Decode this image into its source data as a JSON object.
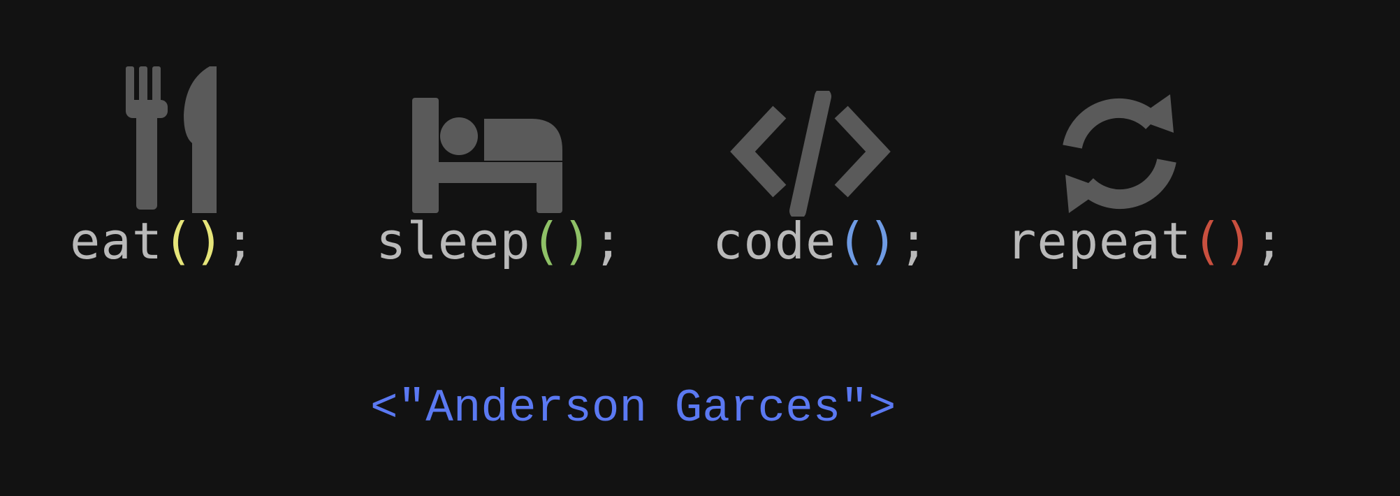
{
  "colors": {
    "background": "#121212",
    "icon": "#5a5a5a",
    "text": "#b9b9b9",
    "eat_parens": "#e6e57a",
    "sleep_parens": "#8fc167",
    "code_parens": "#6f9be3",
    "repeat_parens": "#c9503f",
    "signature": "#5b79f2"
  },
  "items": [
    {
      "icon": "fork-knife-icon",
      "name": "eat",
      "parens": "()",
      "terminator": ";"
    },
    {
      "icon": "bed-icon",
      "name": "sleep",
      "parens": "()",
      "terminator": ";"
    },
    {
      "icon": "code-brackets-icon",
      "name": "code",
      "parens": "()",
      "terminator": ";"
    },
    {
      "icon": "refresh-icon",
      "name": "repeat",
      "parens": "()",
      "terminator": ";"
    }
  ],
  "signature": "<\"Anderson Garces\">"
}
